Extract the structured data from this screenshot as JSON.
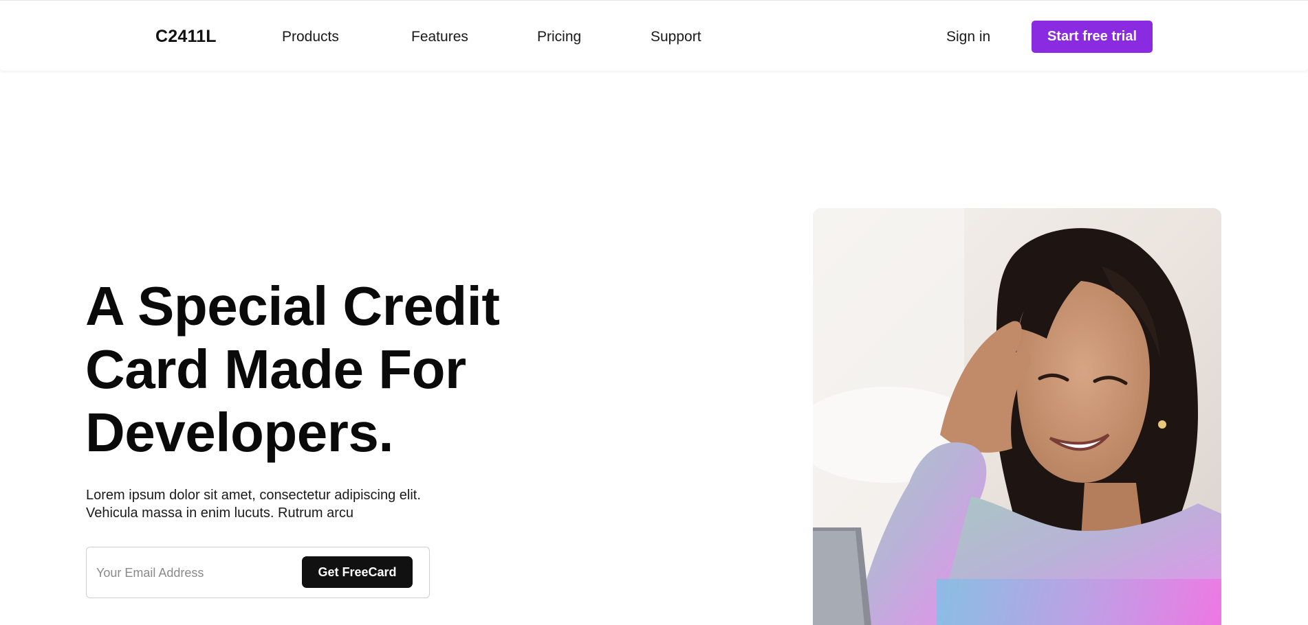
{
  "navbar": {
    "logo": "C2411L",
    "links": [
      "Products",
      "Features",
      "Pricing",
      "Support"
    ],
    "sign_in": "Sign in",
    "cta": "Start free trial"
  },
  "hero": {
    "title_lines": [
      "A Special Credit",
      "Card Made For",
      "Developers."
    ],
    "description_lines": [
      "Lorem ipsum dolor sit amet, consectetur adipiscing elit.",
      "Vehicula massa in enim lucuts. Rutrum arcu"
    ],
    "email_placeholder": "Your Email Address",
    "submit_label": "Get FreeCard"
  },
  "colors": {
    "accent": "#8a2be2",
    "dark_button": "#111111"
  }
}
